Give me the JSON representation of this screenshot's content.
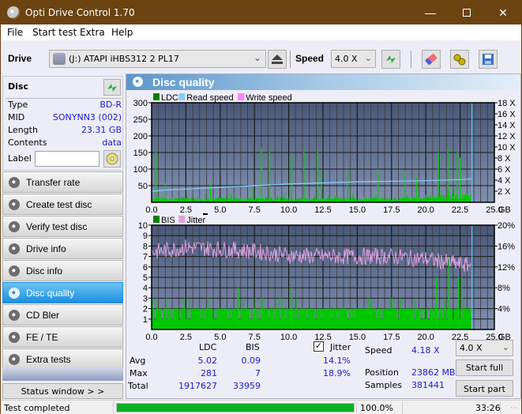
{
  "window": {
    "title": "Opti Drive Control 1.70",
    "controls": [
      "minimize",
      "maximize",
      "close"
    ]
  },
  "menu": [
    "File",
    "Start test",
    "Extra",
    "Help"
  ],
  "toolbar": {
    "drive_label": "Drive",
    "drive_value": "(J:)  ATAPI iHBS312  2 PL17",
    "speed_label": "Speed",
    "speed_value": "4.0 X",
    "icons": [
      "eject-icon",
      "refresh-icon",
      "erase-icon",
      "settings-icon",
      "save-icon"
    ]
  },
  "disc": {
    "header": "Disc",
    "rows": [
      {
        "key": "Type",
        "value": "BD-R"
      },
      {
        "key": "MID",
        "value": "SONYNN3 (002)"
      },
      {
        "key": "Length",
        "value": "23.31 GB"
      },
      {
        "key": "Contents",
        "value": "data"
      }
    ],
    "label_key": "Label",
    "label_value": ""
  },
  "nav": [
    {
      "label": "Transfer rate",
      "active": false
    },
    {
      "label": "Create test disc",
      "active": false
    },
    {
      "label": "Verify test disc",
      "active": false
    },
    {
      "label": "Drive info",
      "active": false
    },
    {
      "label": "Disc info",
      "active": false
    },
    {
      "label": "Disc quality",
      "active": true
    },
    {
      "label": "CD Bler",
      "active": false
    },
    {
      "label": "FE / TE",
      "active": false
    },
    {
      "label": "Extra tests",
      "active": false
    }
  ],
  "status_window_button": "Status window > >",
  "panel": {
    "title": "Disc quality"
  },
  "chart_data": [
    {
      "type": "bar",
      "title": "LDC / Read speed",
      "legend": [
        "LDC",
        "Read speed",
        "Write speed"
      ],
      "legend_colors": [
        "#008000",
        "#87cefa",
        "#ff80ff"
      ],
      "legend_placement": "top-left",
      "xlabel": "GB",
      "x_ticks": [
        "0.0",
        "2.5",
        "5.0",
        "7.5",
        "10.0",
        "12.5",
        "15.0",
        "17.5",
        "20.0",
        "22.5",
        "25.0"
      ],
      "xlim": [
        0,
        25
      ],
      "y_left_ticks": [
        "50",
        "100",
        "150",
        "200",
        "250",
        "300"
      ],
      "ylim_left": [
        0,
        300
      ],
      "y_right_ticks": [
        "2 X",
        "4 X",
        "6 X",
        "8 X",
        "10 X",
        "12 X",
        "14 X",
        "16 X",
        "18 X"
      ],
      "ylim_right": [
        0,
        18
      ],
      "data_end_gb": 23.31,
      "ldc_baseline_approx": 12,
      "ldc_spikes": [
        {
          "x": 0.3,
          "y": 152
        },
        {
          "x": 1.0,
          "y": 58
        },
        {
          "x": 4.3,
          "y": 53
        },
        {
          "x": 7.4,
          "y": 45
        },
        {
          "x": 8.0,
          "y": 162
        },
        {
          "x": 8.6,
          "y": 156
        },
        {
          "x": 10.2,
          "y": 147
        },
        {
          "x": 11.1,
          "y": 157
        },
        {
          "x": 12.1,
          "y": 157
        },
        {
          "x": 12.4,
          "y": 95
        },
        {
          "x": 14.3,
          "y": 95
        },
        {
          "x": 16.5,
          "y": 100
        },
        {
          "x": 18.5,
          "y": 95
        },
        {
          "x": 19.3,
          "y": 75
        },
        {
          "x": 20.9,
          "y": 150
        },
        {
          "x": 21.6,
          "y": 165
        },
        {
          "x": 22.3,
          "y": 155
        },
        {
          "x": 22.5,
          "y": 135
        }
      ],
      "read_speed": [
        {
          "x": 0.0,
          "y": 2.0
        },
        {
          "x": 1.0,
          "y": 2.2
        },
        {
          "x": 2.5,
          "y": 2.4
        },
        {
          "x": 5.0,
          "y": 2.7
        },
        {
          "x": 7.5,
          "y": 3.0
        },
        {
          "x": 10.0,
          "y": 3.3
        },
        {
          "x": 12.5,
          "y": 3.5
        },
        {
          "x": 15.0,
          "y": 3.7
        },
        {
          "x": 17.5,
          "y": 3.8
        },
        {
          "x": 20.0,
          "y": 3.9
        },
        {
          "x": 22.5,
          "y": 4.1
        },
        {
          "x": 23.31,
          "y": 4.2
        }
      ]
    },
    {
      "type": "bar",
      "title": "BIS / Jitter",
      "legend": [
        "BIS",
        "Jitter"
      ],
      "legend_colors": [
        "#008000",
        "#dda0dd"
      ],
      "legend_placement": "top-left",
      "xlabel": "GB",
      "x_ticks": [
        "0.0",
        "2.5",
        "5.0",
        "7.5",
        "10.0",
        "12.5",
        "15.0",
        "17.5",
        "20.0",
        "22.5",
        "25.0"
      ],
      "xlim": [
        0,
        25
      ],
      "y_left_ticks": [
        "1",
        "2",
        "3",
        "4",
        "5",
        "6",
        "7",
        "8",
        "9",
        "10"
      ],
      "ylim_left": [
        0,
        10
      ],
      "y_right_ticks": [
        "4%",
        "8%",
        "12%",
        "16%",
        "20%"
      ],
      "ylim_right": [
        0,
        20
      ],
      "data_end_gb": 23.31,
      "bis_baseline": 1,
      "bis_spikes": [
        {
          "x": 6.3,
          "y": 4
        },
        {
          "x": 10.2,
          "y": 4
        },
        {
          "x": 20.8,
          "y": 5
        },
        {
          "x": 21.7,
          "y": 7
        },
        {
          "x": 22.4,
          "y": 5
        },
        {
          "x": 22.6,
          "y": 5
        }
      ],
      "jitter_profile": [
        {
          "x": 0.0,
          "y": 14.8
        },
        {
          "x": 2.5,
          "y": 15.8
        },
        {
          "x": 5.0,
          "y": 15.4
        },
        {
          "x": 7.5,
          "y": 15.0
        },
        {
          "x": 10.0,
          "y": 14.2
        },
        {
          "x": 12.5,
          "y": 14.0
        },
        {
          "x": 15.0,
          "y": 14.0
        },
        {
          "x": 17.5,
          "y": 14.0
        },
        {
          "x": 20.0,
          "y": 13.5
        },
        {
          "x": 22.5,
          "y": 12.5
        },
        {
          "x": 23.31,
          "y": 12.2
        }
      ]
    }
  ],
  "stats": {
    "col_ldc": "LDC",
    "col_bis": "BIS",
    "jitter_label": "Jitter",
    "jitter_checked": true,
    "rows": [
      {
        "label": "Avg",
        "ldc": "5.02",
        "bis": "0.09",
        "jitter": "14.1%"
      },
      {
        "label": "Max",
        "ldc": "281",
        "bis": "7",
        "jitter": "18.9%"
      },
      {
        "label": "Total",
        "ldc": "1917627",
        "bis": "33959",
        "jitter": ""
      }
    ],
    "speed_label": "Speed",
    "speed_value": "4.18 X",
    "position_label": "Position",
    "position_value": "23862 MB",
    "samples_label": "Samples",
    "samples_value": "381441",
    "speed_select": "4.0 X",
    "start_full": "Start full",
    "start_part": "Start part"
  },
  "statusbar": {
    "text": "Test completed",
    "progress_percent": 100.0,
    "progress_label": "100.0%",
    "elapsed": "33:26"
  }
}
